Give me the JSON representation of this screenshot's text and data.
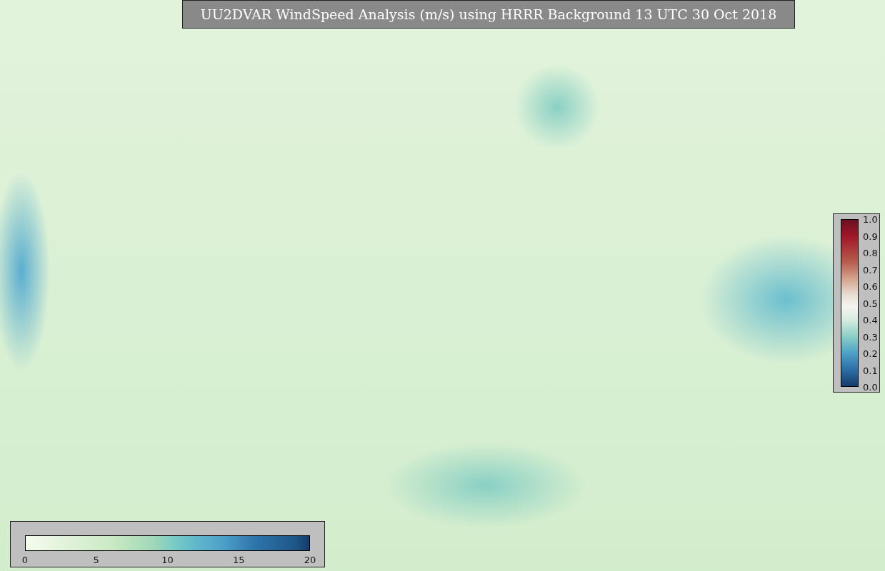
{
  "title": "UU2DVAR WindSpeed Analysis (m/s) using HRRR Background 13 UTC 30 Oct 2018",
  "wind_colorbar": {
    "ticks": [
      "0",
      "5",
      "10",
      "15",
      "20"
    ]
  },
  "ratio_colorbar": {
    "ticks": [
      "1.0",
      "0.9",
      "0.8",
      "0.7",
      "0.6",
      "0.5",
      "0.4",
      "0.3",
      "0.2",
      "0.1",
      "0.0"
    ]
  }
}
